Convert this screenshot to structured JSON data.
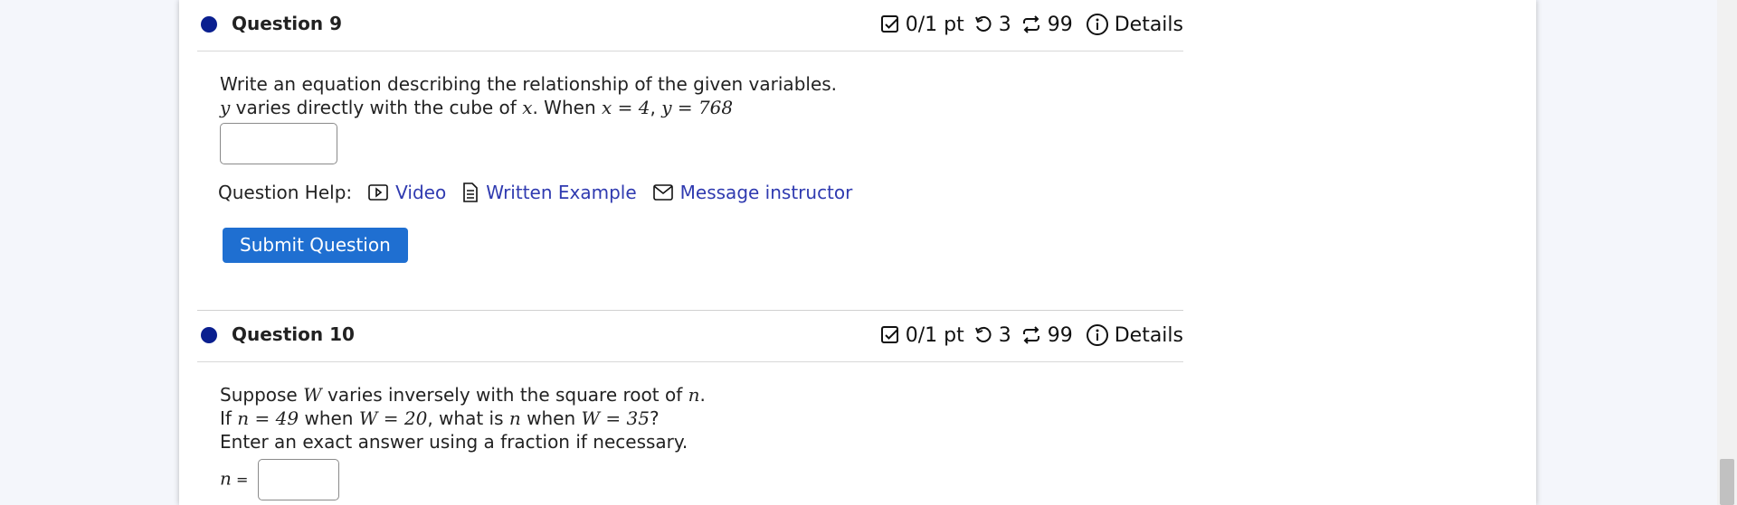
{
  "questions": [
    {
      "title": "Question 9",
      "score": "0/1 pt",
      "retries": "3",
      "attempts": "99",
      "details_label": "Details",
      "line1": "Write an equation describing the relationship of the given variables.",
      "line2_var_y": "y",
      "line2_text_a": " varies directly with the cube of ",
      "line2_var_x": "x",
      "line2_text_b": ". When ",
      "line2_cond1": "x = 4",
      "line2_sep": ", ",
      "line2_cond2": "y = 768"
    },
    {
      "title": "Question 10",
      "score": "0/1 pt",
      "retries": "3",
      "attempts": "99",
      "details_label": "Details",
      "l1_a": "Suppose ",
      "l1_W": "W",
      "l1_b": " varies inversely with the square root of ",
      "l1_n": "n",
      "l1_c": ".",
      "l2_a": "If ",
      "l2_m1": "n = 49",
      "l2_b": " when ",
      "l2_m2": "W = 20",
      "l2_c": ", what is ",
      "l2_m3": "n",
      "l2_d": " when ",
      "l2_m4": "W = 35",
      "l2_e": "?",
      "line3": "Enter an exact answer using a fraction if necessary.",
      "answer_prefix_var": "n",
      "answer_prefix_eq": " ="
    }
  ],
  "help": {
    "label": "Question Help:",
    "video": "Video",
    "written_example": "Written Example",
    "message": "Message instructor"
  },
  "submit_label": "Submit Question",
  "colors": {
    "link": "#2f3ab0",
    "button": "#1f6fd1",
    "dot": "#0a1f8f"
  },
  "icons": [
    "checkbox-icon",
    "retry-icon",
    "attempts-icon",
    "info-icon",
    "video-icon",
    "document-icon",
    "mail-icon"
  ]
}
